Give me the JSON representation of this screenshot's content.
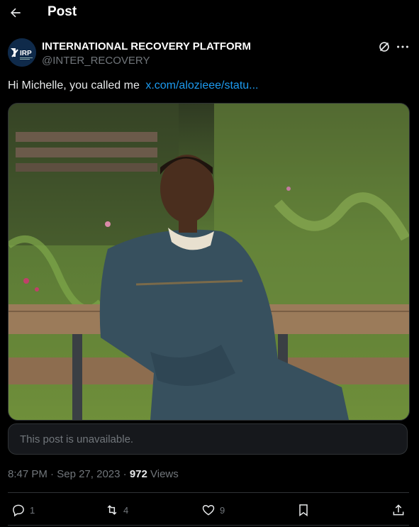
{
  "header": {
    "title": "Post"
  },
  "author": {
    "display_name": "INTERNATIONAL RECOVERY PLATFORM",
    "handle": "@INTER_RECOVERY",
    "avatar_text": "IRP"
  },
  "post": {
    "text": "Hi Michelle, you called me",
    "link_text": "x.com/alozieee/statu..."
  },
  "quote": {
    "unavailable_text": "This post is unavailable."
  },
  "meta": {
    "time": "8:47 PM",
    "dot1": " · ",
    "date": "Sep 27, 2023",
    "dot2": " · ",
    "views_count": "972",
    "views_label": " Views"
  },
  "actions": {
    "replies": "1",
    "reposts": "4",
    "likes": "9"
  },
  "icons": {
    "back": "arrow-left-icon",
    "verify": "circle-slash-icon",
    "more": "more-horizontal-icon",
    "reply": "reply-icon",
    "repost": "repost-icon",
    "like": "heart-icon",
    "bookmark": "bookmark-icon",
    "share": "share-icon"
  },
  "colors": {
    "link": "#1d9bf0",
    "muted": "#71767b",
    "text": "#e7e9ea",
    "avatar_bg": "#0f2a4a"
  }
}
